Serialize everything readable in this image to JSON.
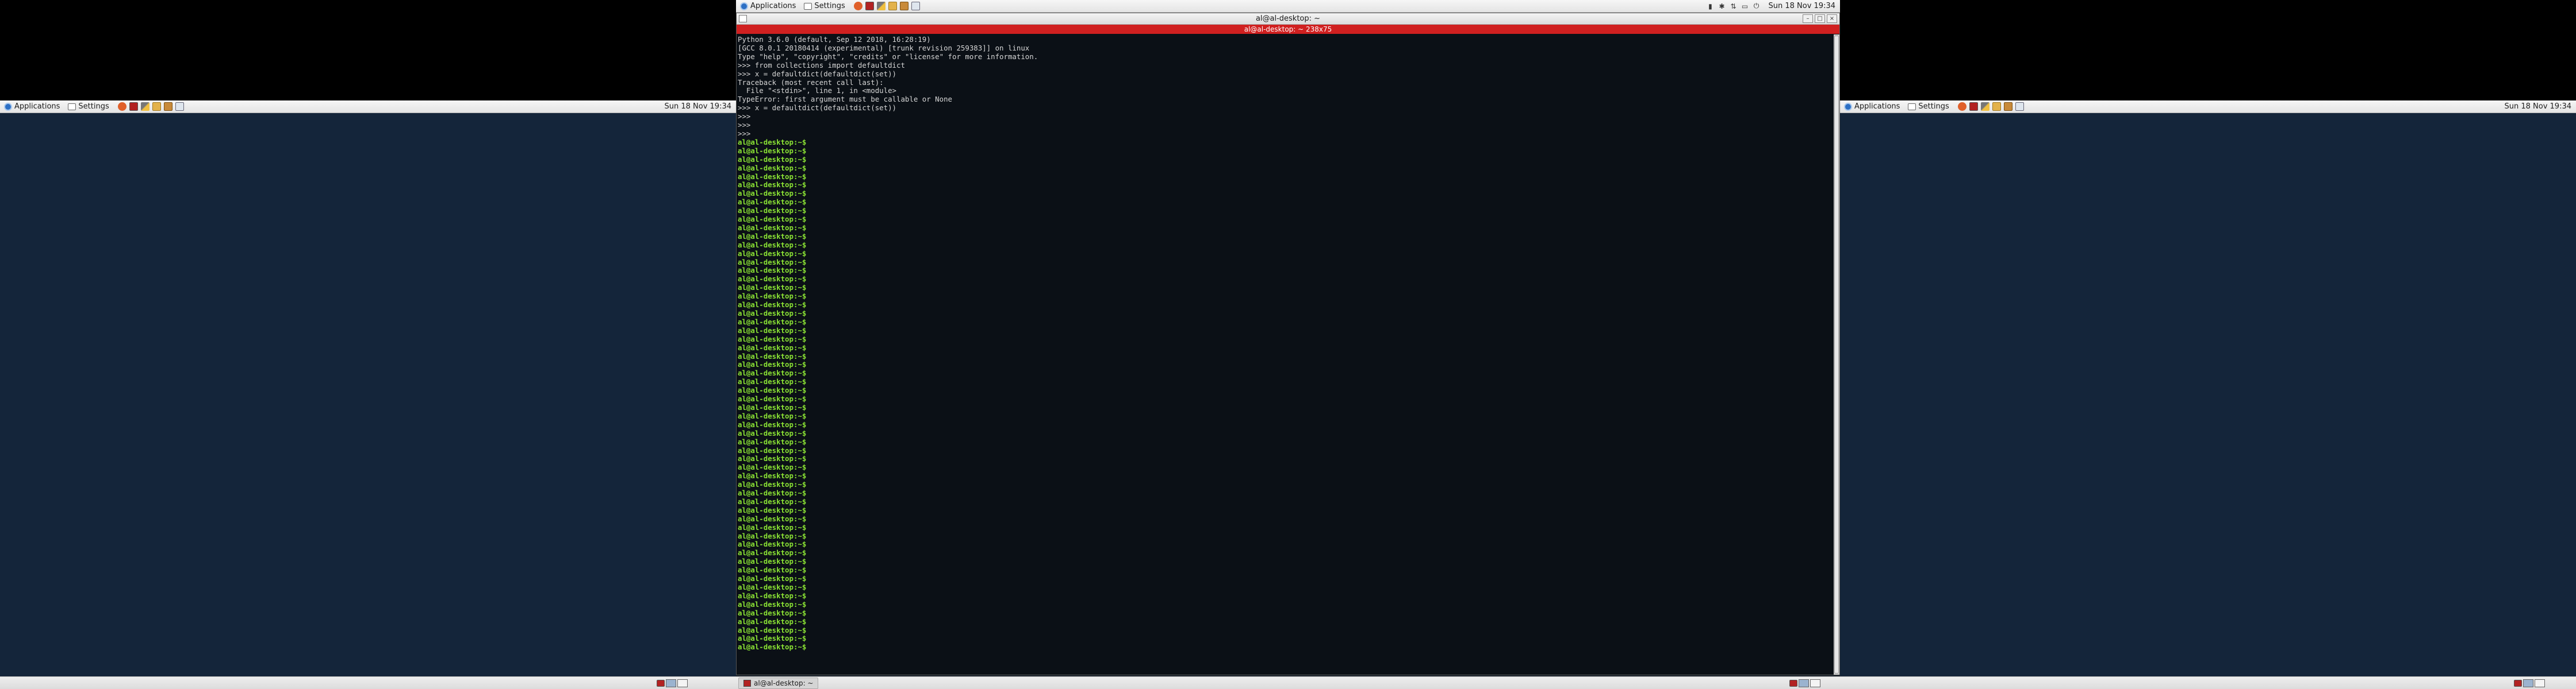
{
  "panel": {
    "applications_label": "Applications",
    "settings_label": "Settings",
    "clock": "Sun 18 Nov 19:34",
    "launchers": [
      "browser-icon",
      "terminal-icon",
      "text-editor-icon",
      "file-manager-icon",
      "archive-icon",
      "screenshot-icon"
    ]
  },
  "terminal": {
    "window_title": "al@al-desktop: ~",
    "tab_title": "al@al-desktop: ~ 238x75",
    "prompt_host": "al@al-desktop",
    "prompt_suffix": ":~$",
    "prompt_repeat": 60,
    "output_lines": [
      "Python 3.6.0 (default, Sep 12 2018, 16:28:19)",
      "[GCC 8.0.1 20180414 (experimental) [trunk revision 259383]] on linux",
      "Type \"help\", \"copyright\", \"credits\" or \"license\" for more information.",
      ">>> from collections import defaultdict",
      ">>> x = defaultdict(defaultdict(set))",
      "Traceback (most recent call last):",
      "  File \"<stdin>\", line 1, in <module>",
      "TypeError: first argument must be callable or None",
      ">>> x = defaultdict(defaultdict(set))",
      ">>>",
      ">>>",
      ">>>"
    ]
  },
  "taskbar": {
    "active_task": "al@al-desktop: ~"
  }
}
